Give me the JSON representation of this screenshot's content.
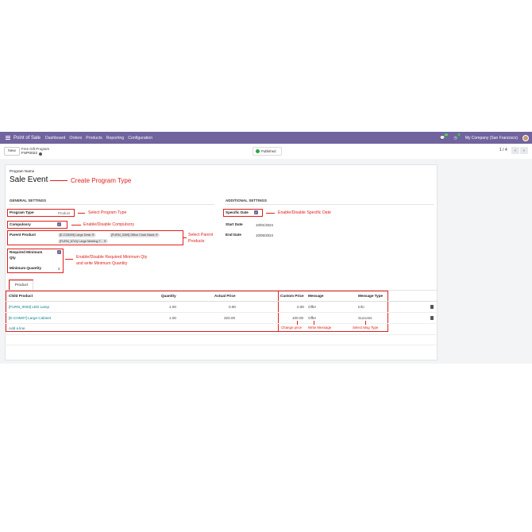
{
  "navbar": {
    "app": "Point of Sale",
    "menu": [
      "Dashboard",
      "Orders",
      "Products",
      "Reporting",
      "Configuration"
    ],
    "chat_count": "19",
    "activity_count": "7",
    "company": "My Company (San Francisco)"
  },
  "control": {
    "new_label": "New",
    "breadcrumb_title": "Free Gift Program",
    "record_ref": "FSP0022",
    "status_label": "Published",
    "pager": "1 / 4"
  },
  "form": {
    "program_name_label": "Program Name",
    "program_name_value": "Sale Event",
    "general_title": "GENERAL SETTINGS",
    "additional_title": "ADDITIONAL SETTINGS",
    "program_type_label": "Program Type",
    "program_type_value": "Product",
    "compulsory_label": "Compulsory",
    "parent_product_label": "Parent Product",
    "parent_products": [
      "[E-COM09] Large Desk",
      "[FURN_0269] Office Chair Black",
      "[FURN_6741] Large Meeting T..."
    ],
    "required_min_label_1": "Required Minimum",
    "required_min_label_2": "Qty",
    "min_quantity_label": "Minimum Quantity",
    "min_quantity_value": "2",
    "specific_date_label": "Specific Date",
    "start_date_label": "Start Date",
    "start_date_value": "10/01/2024",
    "end_date_label": "End Date",
    "end_date_value": "10/05/2024"
  },
  "tab": {
    "product_label": "Product"
  },
  "table": {
    "headers": {
      "child_product": "Child Product",
      "quantity": "Quantity",
      "actual_price": "Actual Price",
      "custom_price": "Custom Price",
      "message": "Message",
      "message_type": "Message Type"
    },
    "rows": [
      {
        "child_product": "[FURN_0003] LED Lamp",
        "quantity": "1.00",
        "actual_price": "0.90",
        "custom_price": "0.90",
        "message": "Offer",
        "message_type": "Info"
      },
      {
        "child_product": "[E-COM07] Large Cabinet",
        "quantity": "1.00",
        "actual_price": "320.00",
        "custom_price": "100.00",
        "message": "Offer",
        "message_type": "Success"
      }
    ],
    "add_line": "Add a line"
  },
  "annotations": {
    "create_program_type": "Create Program Type",
    "select_program_type": "Select Program Type",
    "enable_compulsory": "Enable/Disable Compulsory",
    "select_parent_1": "Select Parent",
    "select_parent_2": "Products",
    "enable_min_qty_1": "Enable/Disable Required Minimum Qty",
    "enable_min_qty_2": "and write Minimum Quantity",
    "enable_specific_date": "Enable/Disable Specific Date",
    "change_price": "Change price",
    "write_message": "Write Message",
    "select_msg_type": "Select Msg Type"
  },
  "colors": {
    "brand": "#71639e",
    "annotation": "#e0201c",
    "link": "#017e84"
  }
}
